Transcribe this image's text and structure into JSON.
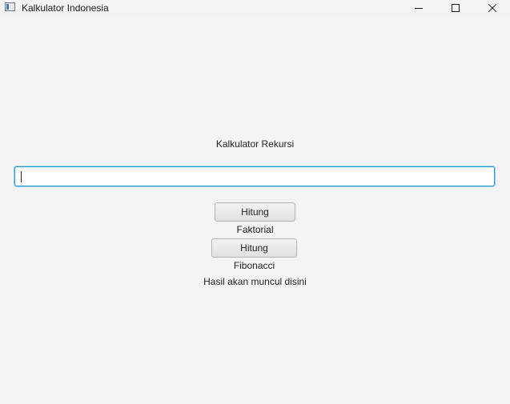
{
  "window": {
    "title": "Kalkulator Indonesia",
    "icon": "java-app-icon",
    "controls": [
      "minimize-icon",
      "maximize-icon",
      "close-icon"
    ]
  },
  "main": {
    "heading": "Kalkulator Rekursi",
    "input": {
      "value": "",
      "placeholder": ""
    },
    "buttons": {
      "factorial_label": "Hitung Faktorial",
      "fibonacci_label": "Hitung Fibonacci"
    },
    "result_text": "Hasil akan muncul disini"
  },
  "colors": {
    "background": "#f4f4f4",
    "input_focus_border": "#2f9fd0"
  }
}
